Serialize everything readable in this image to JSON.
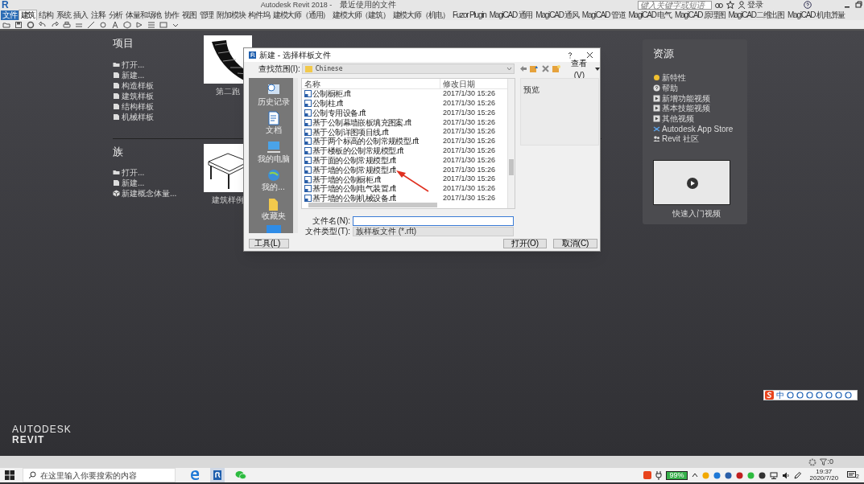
{
  "title_bar": {
    "logo": "R",
    "app_title": "Autodesk Revit 2018 -",
    "document": "最近使用的文件",
    "search_placeholder": "键入关键字或短语",
    "sign_in": "登录"
  },
  "ribbon_tabs": [
    {
      "label": "文件",
      "kind": "app",
      "selected": false
    },
    {
      "label": "建筑",
      "kind": "tab",
      "selected": true
    },
    {
      "label": "结构",
      "kind": "tab",
      "selected": false
    },
    {
      "label": "系统",
      "kind": "tab",
      "selected": false
    },
    {
      "label": "插入",
      "kind": "tab",
      "selected": false
    },
    {
      "label": "注释",
      "kind": "tab",
      "selected": false
    },
    {
      "label": "分析",
      "kind": "tab",
      "selected": false
    },
    {
      "label": "体量和场地",
      "kind": "tab",
      "selected": false
    },
    {
      "label": "协作",
      "kind": "tab",
      "selected": false
    },
    {
      "label": "视图",
      "kind": "tab",
      "selected": false
    },
    {
      "label": "管理",
      "kind": "tab",
      "selected": false
    },
    {
      "label": "附加模块",
      "kind": "tab",
      "selected": false
    },
    {
      "label": "构件坞",
      "kind": "tab",
      "selected": false
    },
    {
      "label": "建模大师（通用）",
      "kind": "tab",
      "selected": false
    },
    {
      "label": "建模大师（建筑）",
      "kind": "tab",
      "selected": false
    },
    {
      "label": "建模大师（机电）",
      "kind": "tab",
      "selected": false
    },
    {
      "label": "Fuzor Plugin",
      "kind": "tab",
      "selected": false
    },
    {
      "label": "MagiCAD 通用",
      "kind": "tab",
      "selected": false
    },
    {
      "label": "MagiCAD 通风",
      "kind": "tab",
      "selected": false
    },
    {
      "label": "MagiCAD 管道",
      "kind": "tab",
      "selected": false
    },
    {
      "label": "MagiCAD 电气",
      "kind": "tab",
      "selected": false
    },
    {
      "label": "MagiCAD 原理图",
      "kind": "tab",
      "selected": false
    },
    {
      "label": "MagiCAD二维出图",
      "kind": "tab",
      "selected": false
    },
    {
      "label": "MagiCAD 机电算量",
      "kind": "tab",
      "selected": false
    }
  ],
  "projects": {
    "heading": "项目",
    "items": [
      {
        "label": "打开...",
        "kind": "open"
      },
      {
        "label": "新建...",
        "kind": "new"
      },
      {
        "label": "构造样板",
        "kind": "new"
      },
      {
        "label": "建筑样板",
        "kind": "new"
      },
      {
        "label": "结构样板",
        "kind": "new"
      },
      {
        "label": "机械样板",
        "kind": "new"
      }
    ],
    "recent_caption": "第二跑"
  },
  "families": {
    "heading": "族",
    "items": [
      {
        "label": "打开...",
        "kind": "open"
      },
      {
        "label": "新建...",
        "kind": "new"
      },
      {
        "label": "新建概念体量...",
        "kind": "mass"
      }
    ],
    "recent_caption": "建筑样例"
  },
  "dialog": {
    "title": "新建 - 选择样板文件",
    "look_in_label": "查找范围(I):",
    "look_in": "Chinese",
    "view_menu": "查看(V)",
    "preview_label": "预览",
    "places": [
      "历史记录",
      "文档",
      "我的电脑",
      "我的...",
      "收藏夹"
    ],
    "columns": [
      "名称",
      "修改日期"
    ],
    "files": [
      {
        "name": "公制橱柜.rft",
        "modified": "2017/1/30 15:26"
      },
      {
        "name": "公制柱.rft",
        "modified": "2017/1/30 15:26"
      },
      {
        "name": "公制专用设备.rft",
        "modified": "2017/1/30 15:26"
      },
      {
        "name": "基于公制幕墙嵌板填充图案.rft",
        "modified": "2017/1/30 15:26"
      },
      {
        "name": "基于公制详图项目线.rft",
        "modified": "2017/1/30 15:26"
      },
      {
        "name": "基于两个标高的公制常规模型.rft",
        "modified": "2017/1/30 15:26"
      },
      {
        "name": "基于楼板的公制常规模型.rft",
        "modified": "2017/1/30 15:26"
      },
      {
        "name": "基于面的公制常规模型.rft",
        "modified": "2017/1/30 15:26"
      },
      {
        "name": "基于墙的公制常规模型.rft",
        "modified": "2017/1/30 15:26"
      },
      {
        "name": "基于墙的公制橱柜.rft",
        "modified": "2017/1/30 15:26"
      },
      {
        "name": "基于墙的公制电气装置.rft",
        "modified": "2017/1/30 15:26"
      },
      {
        "name": "基于墙的公制机械设备.rft",
        "modified": "2017/1/30 15:26"
      }
    ],
    "file_name_label": "文件名(N):",
    "file_type_label": "文件类型(T):",
    "file_type": "族样板文件 (*.rft)",
    "tools_button": "工具(L)",
    "open_button": "打开(O)",
    "cancel_button": "取消(C)"
  },
  "resources": {
    "heading": "资源",
    "items": [
      {
        "label": "新特性",
        "kind": "whatsnew"
      },
      {
        "label": "帮助",
        "kind": "help"
      },
      {
        "label": "新增功能视频",
        "kind": "video"
      },
      {
        "label": "基本技能视频",
        "kind": "video"
      },
      {
        "label": "其他视频",
        "kind": "video"
      },
      {
        "label": "Autodesk App Store",
        "kind": "store"
      },
      {
        "label": "Revit 社区",
        "kind": "community"
      }
    ],
    "video_caption": "快速入门视频"
  },
  "ime_toolbar": {
    "mode": "中"
  },
  "brand": {
    "line1": "AUTODESK",
    "line2": "REVIT"
  },
  "status_bar": {
    "filter_count": ":0"
  },
  "taskbar": {
    "search_placeholder": "在这里输入你要搜索的内容",
    "battery": "99%",
    "time": "19:37",
    "date": "2020/7/20",
    "notifications": "2"
  }
}
